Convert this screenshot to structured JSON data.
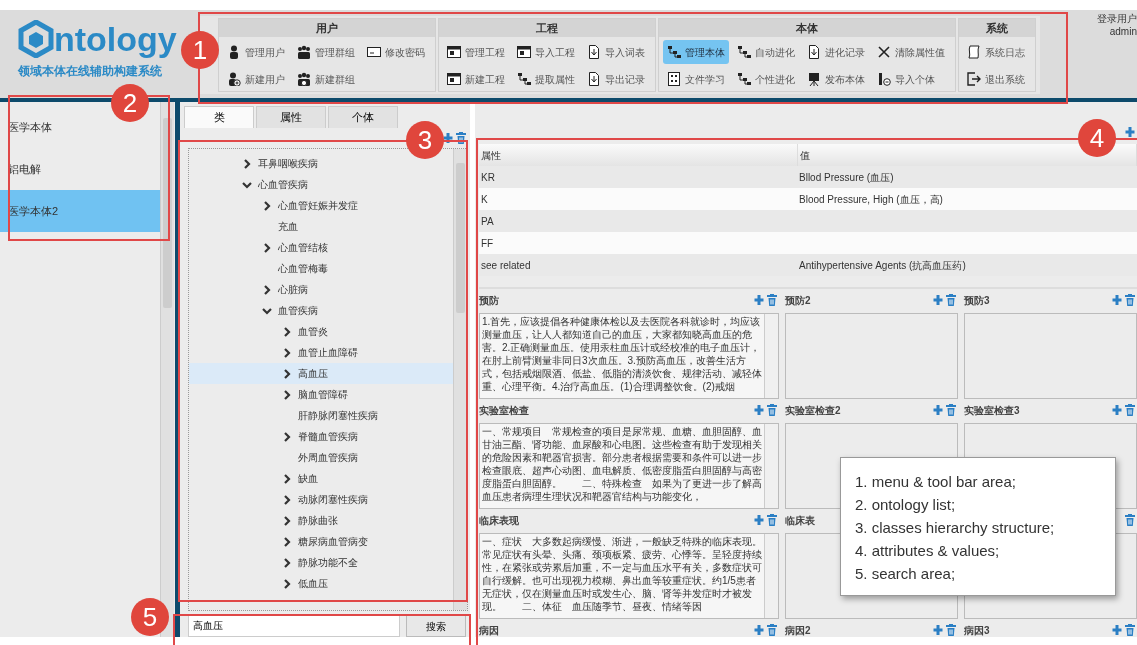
{
  "logo": {
    "text": "ntology",
    "subtitle": "领域本体在线辅助构建系统"
  },
  "toolbar": [
    {
      "title": "用户",
      "rows": [
        [
          {
            "label": "管理用户",
            "selected": false
          },
          {
            "label": "管理群组",
            "selected": false
          },
          {
            "label": "修改密码",
            "selected": false
          }
        ],
        [
          {
            "label": "新建用户",
            "selected": false
          },
          {
            "label": "新建群组",
            "selected": false
          }
        ]
      ]
    },
    {
      "title": "工程",
      "rows": [
        [
          {
            "label": "管理工程",
            "selected": false
          },
          {
            "label": "导入工程",
            "selected": false
          },
          {
            "label": "导入词表",
            "selected": false
          }
        ],
        [
          {
            "label": "新建工程",
            "selected": false
          },
          {
            "label": "提取属性",
            "selected": false
          },
          {
            "label": "导出记录",
            "selected": false
          }
        ]
      ]
    },
    {
      "title": "本体",
      "rows": [
        [
          {
            "label": "管理本体",
            "selected": true
          },
          {
            "label": "自动进化",
            "selected": false
          },
          {
            "label": "进化记录",
            "selected": false
          },
          {
            "label": "清除属性值",
            "selected": false
          }
        ],
        [
          {
            "label": "文件学习",
            "selected": false
          },
          {
            "label": "个性进化",
            "selected": false
          },
          {
            "label": "发布本体",
            "selected": false
          },
          {
            "label": "导入个体",
            "selected": false
          }
        ]
      ]
    },
    {
      "title": "系统",
      "rows": [
        [
          {
            "label": "系统日志",
            "selected": false
          }
        ],
        [
          {
            "label": "退出系统",
            "selected": false
          }
        ]
      ]
    }
  ],
  "login": {
    "label": "登录用户",
    "user": "admin"
  },
  "ontology_list": [
    {
      "label": "医学本体",
      "selected": false
    },
    {
      "label": "铝电解",
      "selected": false
    },
    {
      "label": "医学本体2",
      "selected": true
    }
  ],
  "tabs": [
    {
      "label": "类",
      "selected": true
    },
    {
      "label": "属性",
      "selected": false
    },
    {
      "label": "个体",
      "selected": false
    }
  ],
  "tree": [
    {
      "label": "耳鼻咽喉疾病",
      "expanded": false,
      "selected": false
    },
    {
      "label": "心血管疾病",
      "expanded": true,
      "selected": false,
      "children": [
        {
          "label": "心血管妊娠并发症",
          "expanded": false,
          "selected": false
        },
        {
          "label": "充血",
          "selected": false
        },
        {
          "label": "心血管结核",
          "expanded": false,
          "selected": false
        },
        {
          "label": "心血管梅毒",
          "selected": false
        },
        {
          "label": "心脏病",
          "expanded": false,
          "selected": false
        },
        {
          "label": "血管疾病",
          "expanded": true,
          "selected": false,
          "children": [
            {
              "label": "血管炎",
              "expanded": false,
              "selected": false
            },
            {
              "label": "血管止血障碍",
              "expanded": false,
              "selected": false
            },
            {
              "label": "高血压",
              "expanded": false,
              "selected": true
            },
            {
              "label": "脑血管障碍",
              "expanded": false,
              "selected": false
            },
            {
              "label": "肝静脉闭塞性疾病",
              "selected": false
            },
            {
              "label": "脊髓血管疾病",
              "expanded": false,
              "selected": false
            },
            {
              "label": "外周血管疾病",
              "selected": false
            },
            {
              "label": "缺血",
              "expanded": false,
              "selected": false
            },
            {
              "label": "动脉闭塞性疾病",
              "expanded": false,
              "selected": false
            },
            {
              "label": "静脉曲张",
              "expanded": false,
              "selected": false
            },
            {
              "label": "糖尿病血管病变",
              "expanded": false,
              "selected": false
            },
            {
              "label": "静脉功能不全",
              "expanded": false,
              "selected": false
            },
            {
              "label": "低血压",
              "expanded": false,
              "selected": false
            }
          ]
        }
      ]
    }
  ],
  "search": {
    "value": "高血压",
    "button": "搜索"
  },
  "table": {
    "columns": [
      "属性",
      "值"
    ],
    "rows": [
      [
        "KR",
        "Bllod Pressure (血压)"
      ],
      [
        "K",
        "Blood Pressure, High (血压，高)"
      ],
      [
        "PA",
        ""
      ],
      [
        "FF",
        ""
      ],
      [
        "see related",
        "Antihypertensive Agents (抗高血压药)"
      ]
    ]
  },
  "panels": [
    {
      "title": "预防",
      "text": "1.首先，应该提倡各种健康体检以及去医院各科就诊时，均应该测量血压，让人人都知道自己的血压，大家都知晓高血压的危害。2.正确测量血压。使用汞柱血压计或经校准的电子血压计，在肘上前臂测量非同日3次血压。3.预防高血压，改善生活方式，包括戒烟限酒、低盐、低脂的清淡饮食、规律活动、减轻体重、心理平衡。4.治疗高血压。(1)合理调整饮食。(2)戒烟",
      "add": true,
      "delete": true
    },
    {
      "title": "预防2",
      "add": true,
      "delete": true
    },
    {
      "title": "预防3",
      "add": true,
      "delete": true
    },
    {
      "title": "实验室检查",
      "text": "一、常规项目　常规检查的项目是尿常规、血糖、血胆固醇、血甘油三酯、肾功能、血尿酸和心电图。这些检查有助于发现相关的危险因素和靶器官损害。部分患者根据需要和条件可以进一步检查眼底、超声心动图、血电解质、低密度脂蛋白胆固醇与高密度脂蛋白胆固醇。　　二、特殊检查　如果为了更进一步了解高血压患者病理生理状况和靶器官结构与功能变化，",
      "add": true,
      "delete": true
    },
    {
      "title": "实验室检查2",
      "add": true,
      "delete": true
    },
    {
      "title": "实验室检查3",
      "add": true,
      "delete": true
    },
    {
      "title": "临床表现",
      "text": "一、症状　大多数起病缓慢、渐进，一般缺乏特殊的临床表现。常见症状有头晕、头痛、颈项板紧、疲劳、心悸等。呈轻度持续性，在紧张或劳累后加重，不一定与血压水平有关，多数症状可自行缓解。也可出现视力模糊、鼻出血等较重症状。约1/5患者无症状，仅在测量血压时或发生心、脑、肾等并发症时才被发现。　　二、体征　血压随季节、昼夜、情绪等因",
      "add": true,
      "delete": true
    },
    {
      "title": "临床表",
      "add": false,
      "delete": false
    },
    {
      "add": false,
      "delete": true
    },
    {
      "title": "病因",
      "add": true,
      "delete": true
    },
    {
      "title": "病因2",
      "add": true,
      "delete": true
    },
    {
      "title": "病因3",
      "add": true,
      "delete": true
    }
  ],
  "annotations": [
    "1",
    "2",
    "3",
    "4",
    "5"
  ],
  "legend": [
    "1. menu & tool bar area;",
    "2. ontology list;",
    "3. classes hierarchy structure;",
    "4. attributes & values;",
    "5. search area;"
  ]
}
